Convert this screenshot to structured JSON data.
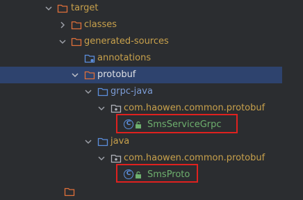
{
  "tree": {
    "target": "target",
    "classes": "classes",
    "generated_sources": "generated-sources",
    "annotations": "annotations",
    "protobuf": "protobuf",
    "grpc_java": "grpc-java",
    "grpc_package": "com.haowen.common.protobuf",
    "sms_service_grpc": "SmsServiceGrpc",
    "java": "java",
    "java_package": "com.haowen.common.protobuf",
    "sms_proto": "SmsProto",
    "class_badge": "C"
  },
  "colors": {
    "excluded_folder": "#c8a14c",
    "normal_text": "#dfe1e5",
    "selection": "#2e436e",
    "highlight_box": "#e0211f",
    "class_icon": "#5c8fde",
    "grpc_folder_text": "#7c9cd6"
  }
}
